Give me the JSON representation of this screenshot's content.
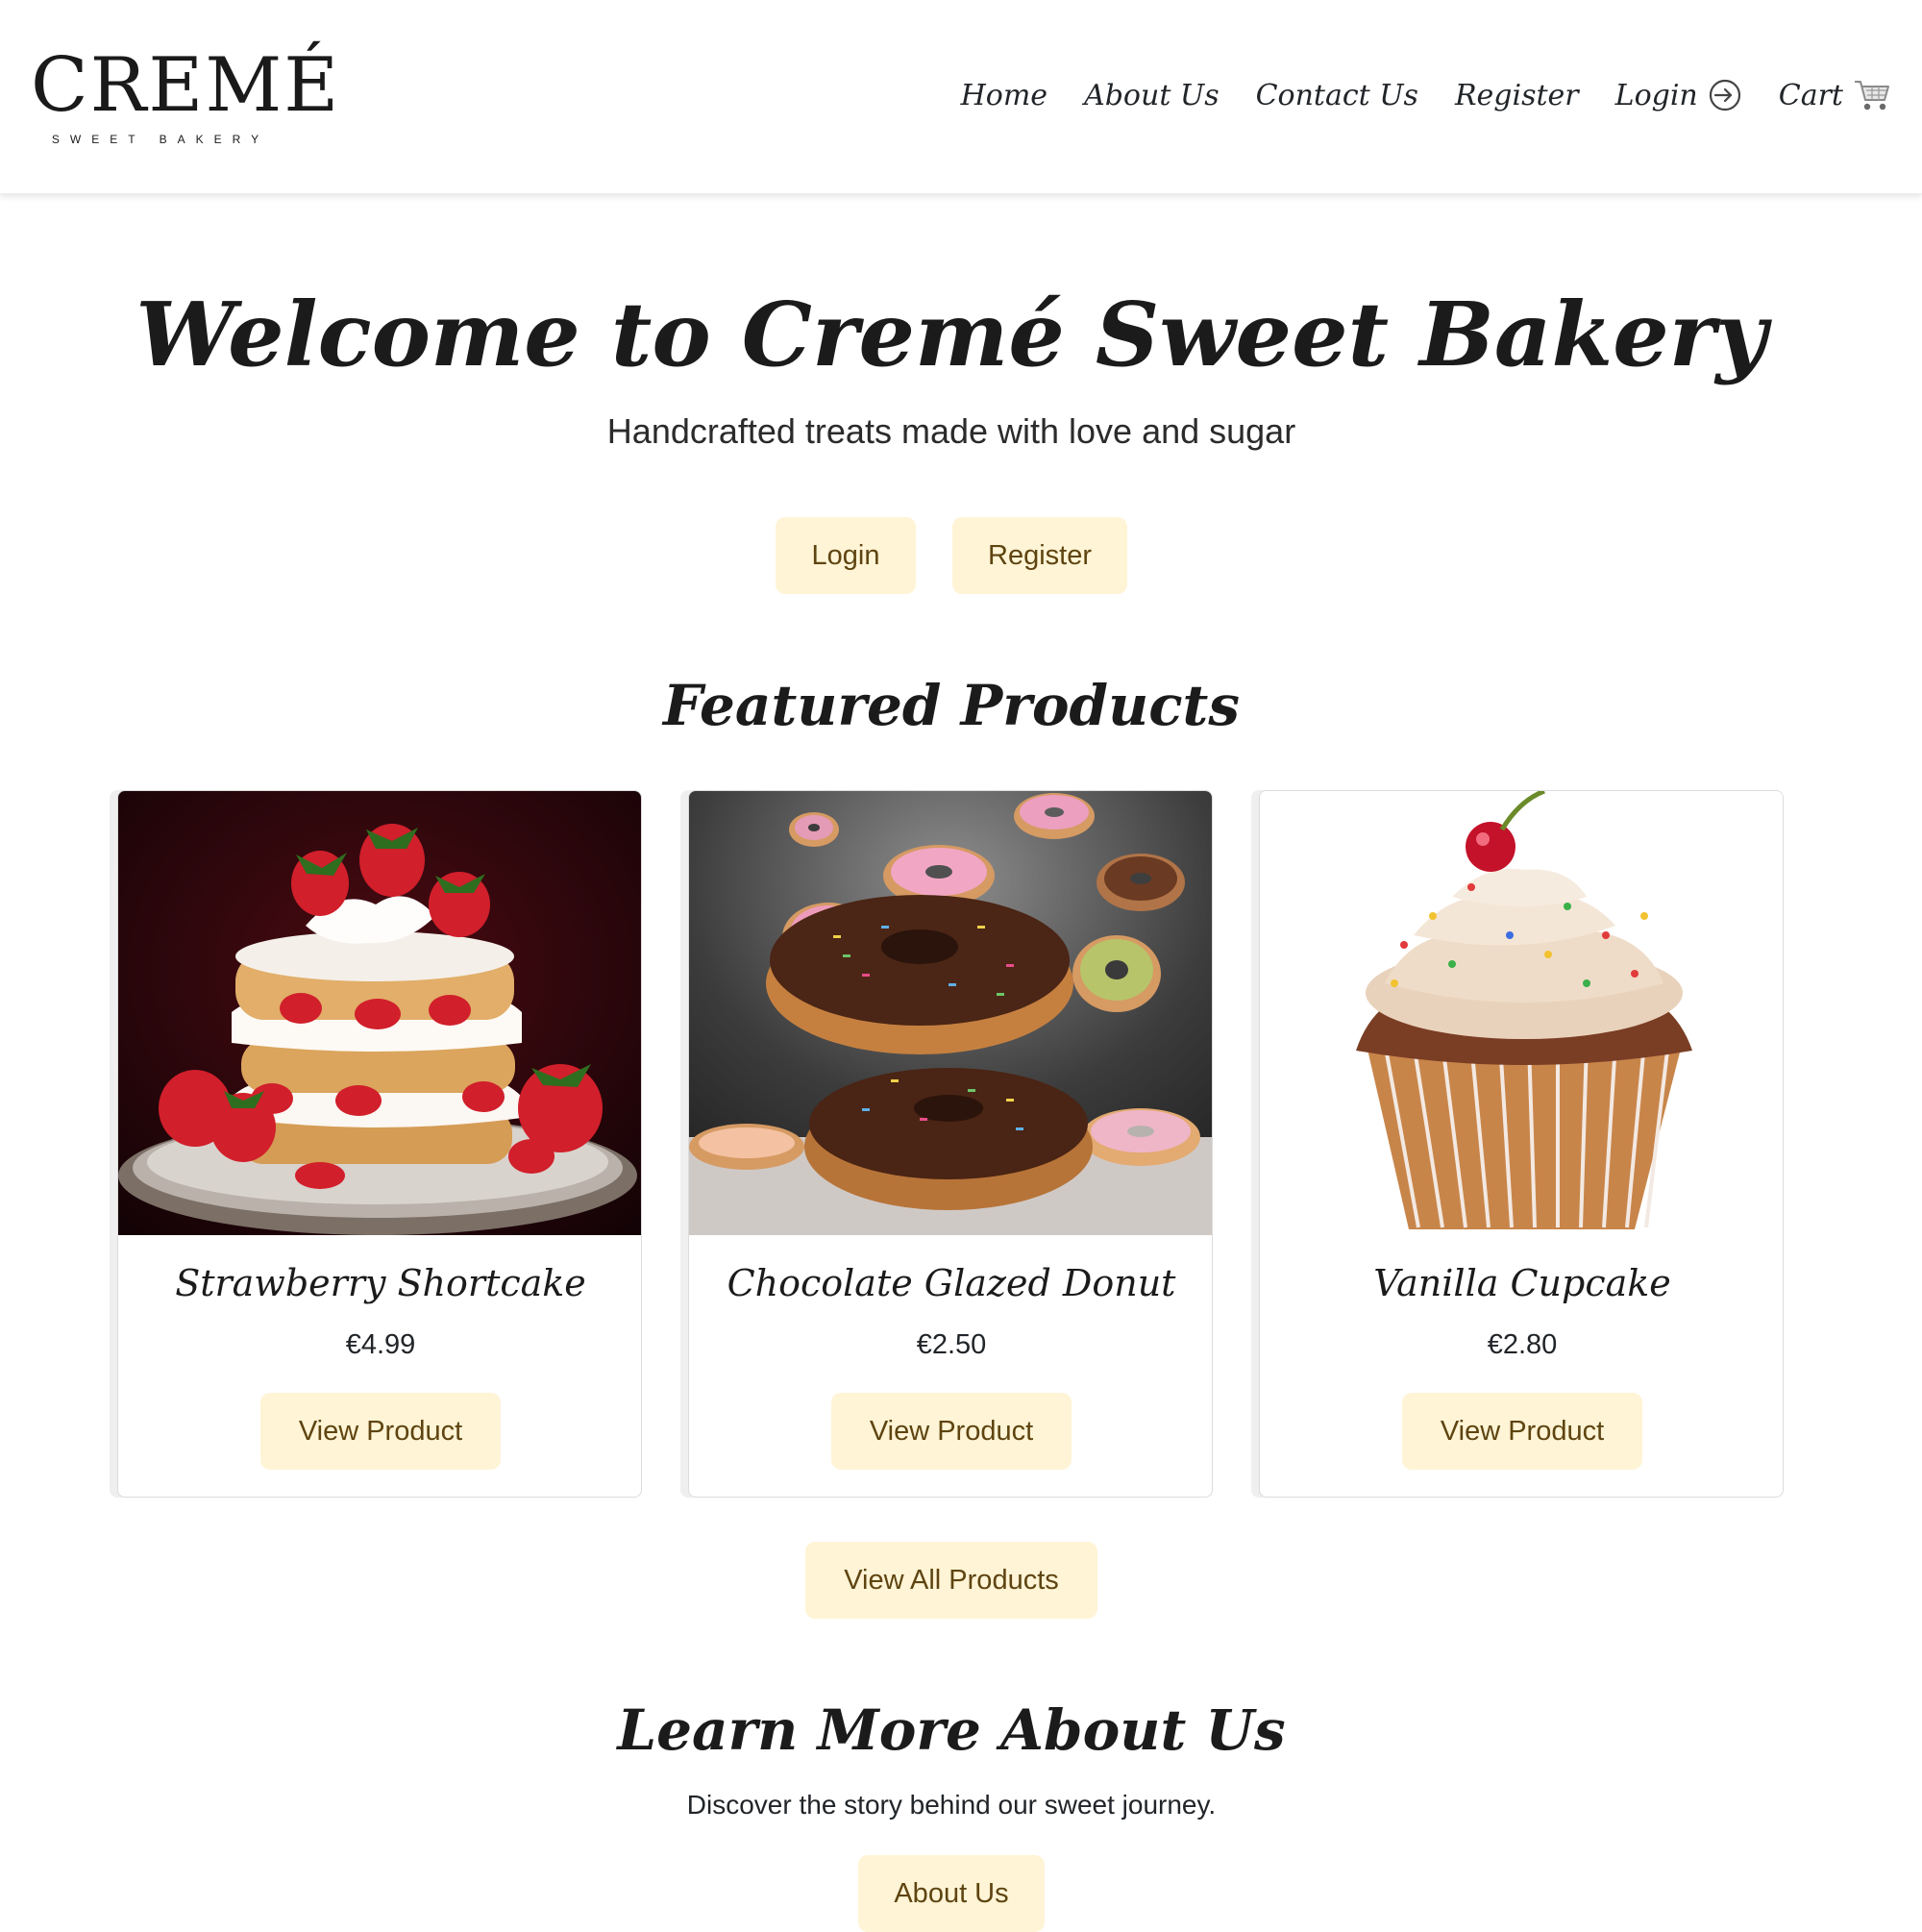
{
  "brand": {
    "logo_word": "CREMÉ",
    "logo_tagline": "SWEET BAKERY"
  },
  "nav": {
    "home": "Home",
    "about": "About Us",
    "contact": "Contact Us",
    "register": "Register",
    "login": "Login",
    "cart": "Cart",
    "login_icon": "login-arrow-icon",
    "cart_icon": "cart-icon"
  },
  "hero": {
    "title": "Welcome to Cremé Sweet Bakery",
    "subtitle": "Handcrafted treats made with love and sugar",
    "login_button": "Login",
    "register_button": "Register"
  },
  "featured": {
    "title": "Featured Products",
    "products": [
      {
        "name": "Strawberry Shortcake",
        "price": "€4.99",
        "button": "View Product",
        "image": "strawberry-shortcake"
      },
      {
        "name": "Chocolate Glazed Donut",
        "price": "€2.50",
        "button": "View Product",
        "image": "chocolate-glazed-donut"
      },
      {
        "name": "Vanilla Cupcake",
        "price": "€2.80",
        "button": "View Product",
        "image": "vanilla-cupcake"
      }
    ],
    "view_all_button": "View All Products"
  },
  "about": {
    "title": "Learn More About Us",
    "subtitle": "Discover the story behind our sweet journey.",
    "button": "About Us"
  },
  "colors": {
    "button_bg": "#fff4d6",
    "button_text": "#5e4410",
    "text": "#212529"
  }
}
